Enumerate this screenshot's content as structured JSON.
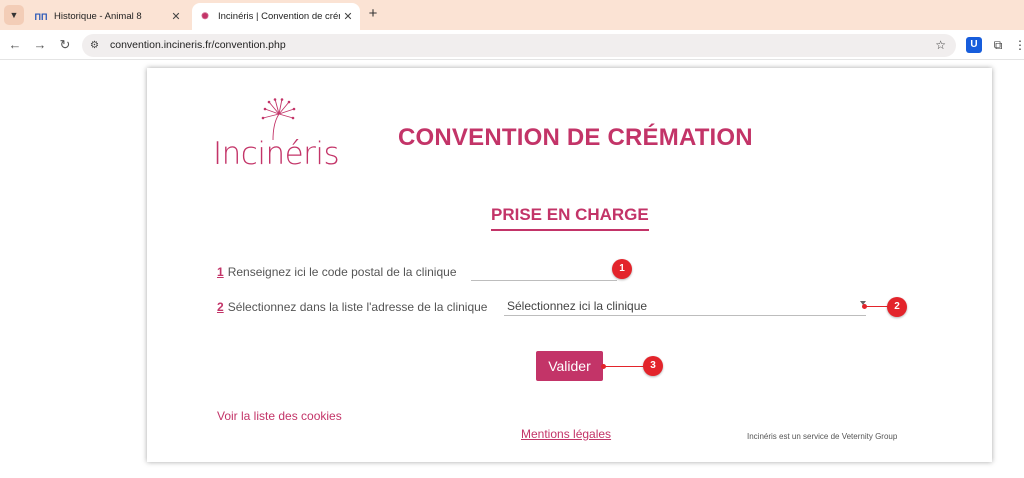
{
  "browser": {
    "tabs": [
      {
        "title": "Historique - Animal 8",
        "active": false,
        "favicon": "ecosystem-icon"
      },
      {
        "title": "Incinéris | Convention de crémati",
        "active": true,
        "favicon": "dandelion-icon"
      }
    ],
    "url": "convention.incineris.fr/convention.php",
    "extensions": [
      "bitwarden-icon",
      "puzzle-icon"
    ]
  },
  "page": {
    "logo_text": "Incinéris",
    "title": "CONVENTION DE CRÉMATION",
    "subtitle": "PRISE EN CHARGE",
    "step1": {
      "number": "1",
      "label": "Renseignez ici le code postal de la clinique",
      "value": ""
    },
    "step2": {
      "number": "2",
      "label": "Sélectionnez dans la liste l'adresse de la clinique",
      "selected": "Sélectionnez ici la clinique"
    },
    "submit_label": "Valider",
    "cookies_link": "Voir la liste des cookies",
    "legal_link": "Mentions légales",
    "footer_note": "Incinéris est un service de Veternity Group"
  },
  "annotations": [
    "1",
    "2",
    "3"
  ],
  "colors": {
    "brand": "#c33468",
    "marker": "#e3242b",
    "tabbar": "#fbe3d4"
  }
}
